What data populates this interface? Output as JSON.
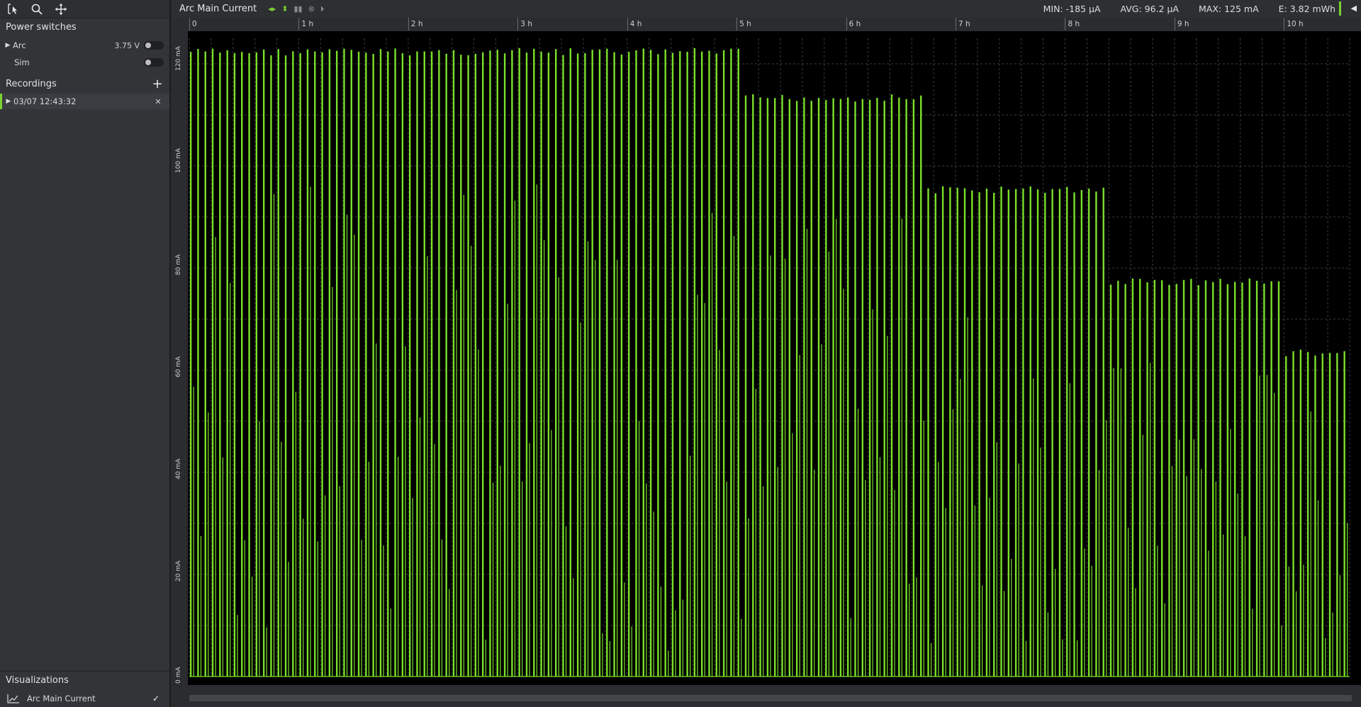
{
  "sidebar": {
    "tools": [
      "cursor-select-icon",
      "zoom-icon",
      "pan-icon"
    ],
    "power_switches": {
      "title": "Power switches",
      "items": [
        {
          "label": "Arc",
          "voltage": "3.75 V",
          "expanded": false,
          "on": false
        },
        {
          "label": "Sim",
          "voltage": "",
          "on": false
        }
      ]
    },
    "recordings": {
      "title": "Recordings",
      "items": [
        {
          "label": "03/07 12:43:32"
        }
      ]
    },
    "visualizations": {
      "title": "Visualizations",
      "items": [
        {
          "label": "Arc Main Current",
          "checked": true
        }
      ]
    }
  },
  "main": {
    "channel_title": "Arc Main Current",
    "stats": {
      "min": "MIN: -185 µA",
      "avg": "AVG: 96.2 µA",
      "max": "MAX: 125 mA",
      "energy": "E: 3.82 mWh"
    }
  },
  "colors": {
    "accent": "#7bd12f",
    "trace": "#7be02a",
    "plot_bg": "#000000",
    "panel_bg": "#323438",
    "grid": "#3c3c3c"
  },
  "chart_data": {
    "type": "line",
    "title": "",
    "xlabel": "",
    "ylabel": "",
    "x_ticks": [
      "0",
      "1 h",
      "2 h",
      "3 h",
      "4 h",
      "5 h",
      "6 h",
      "7 h",
      "8 h",
      "9 h",
      "10 h"
    ],
    "y_ticks": [
      "0 mA",
      "20 mA",
      "40 mA",
      "60 mA",
      "80 mA",
      "100 mA",
      "120 mA"
    ],
    "xlim_h": [
      0,
      10.6
    ],
    "ylim_mA": [
      0,
      125
    ],
    "grid": true,
    "series": [
      {
        "values_note_excluded": true,
        "plateaus_mA": [
          {
            "from_h": 0.0,
            "to_h": 5.05,
            "peak_mA": 123
          },
          {
            "from_h": 5.05,
            "to_h": 6.7,
            "peak_mA": 114
          },
          {
            "from_h": 6.7,
            "to_h": 8.35,
            "peak_mA": 96
          },
          {
            "from_h": 8.35,
            "to_h": 10.0,
            "peak_mA": 78
          },
          {
            "from_h": 10.0,
            "to_h": 10.6,
            "peak_mA": 64
          }
        ],
        "pulse_period_h": 0.0667,
        "baseline_mA": 0
      }
    ]
  }
}
